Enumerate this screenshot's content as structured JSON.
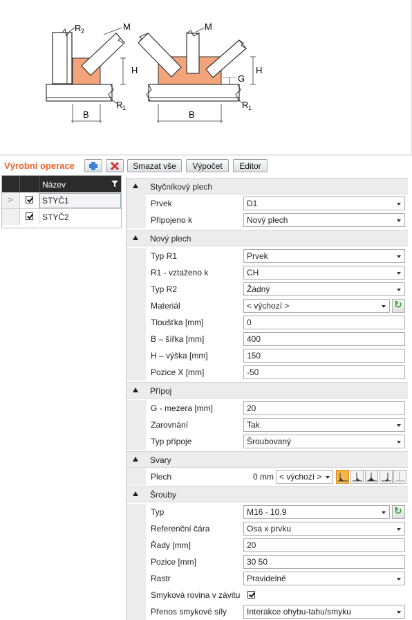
{
  "diagram": {
    "labels": {
      "r2": "R",
      "r2_sub": "2",
      "m_left": "M",
      "m_right": "M",
      "h_left": "H",
      "h_right": "H",
      "g": "G",
      "b_left": "B",
      "b_right": "B",
      "r1_left": "R",
      "r1_left_sub": "1",
      "r1_right": "R",
      "r1_right_sub": "1"
    },
    "plate_color": "#f4a47a"
  },
  "toolbar": {
    "title": "Výrobní operace",
    "add_icon": "add-icon",
    "delete_icon": "delete-icon",
    "clear_all": "Smazat vše",
    "calculate": "Výpočet",
    "editor": "Editor"
  },
  "operations": {
    "header_name": "Název",
    "filter_icon": "filter-icon",
    "rows": [
      {
        "name": "STYČ1",
        "checked": true,
        "selected": true
      },
      {
        "name": "STYČ2",
        "checked": true,
        "selected": false
      }
    ]
  },
  "props": {
    "sec_gusset": "Styčníkový plech",
    "prvek_label": "Prvek",
    "prvek_value": "D1",
    "pripojeno_label": "Připojeno k",
    "pripojeno_value": "Nový plech",
    "sec_newplate": "Nový plech",
    "typr1_label": "Typ R1",
    "typr1_value": "Prvek",
    "r1ref_label": "R1 - vztaženo k",
    "r1ref_value": "CH",
    "typr2_label": "Typ R2",
    "typr2_value": "Žádný",
    "material_label": "Materiál",
    "material_value": "< výchozí >",
    "thickness_label": "Tloušťka [mm]",
    "thickness_value": "0",
    "width_label": "B – šířka [mm]",
    "width_value": "400",
    "height_label": "H – výška [mm]",
    "height_value": "150",
    "posx_label": "Pozice X [mm]",
    "posx_value": "-50",
    "sec_connection": "Přípoj",
    "gap_label": "G - mezera [mm]",
    "gap_value": "20",
    "align_label": "Zarovnání",
    "align_value": "Tak",
    "conntype_label": "Typ přípoje",
    "conntype_value": "Šroubovaný",
    "sec_welds": "Svary",
    "weld_label": "Plech",
    "weld_size": "0 mm",
    "weld_type": "< výchozí >",
    "sec_bolts": "Šrouby",
    "bolttype_label": "Typ",
    "bolttype_value": "M16 - 10.9",
    "refline_label": "Referenční čára",
    "refline_value": "Osa x prvku",
    "rows_label": "Řady [mm]",
    "rows_value": "20",
    "pos_label": "Pozice [mm]",
    "pos_value": "30 50",
    "grid_label": "Rastr",
    "grid_value": "Pravidelně",
    "thread_label": "Smyková rovina v závitu",
    "thread_checked": true,
    "shear_label": "Přenos smykové síly",
    "shear_value": "Interakce ohybu-tahu/smyku"
  }
}
